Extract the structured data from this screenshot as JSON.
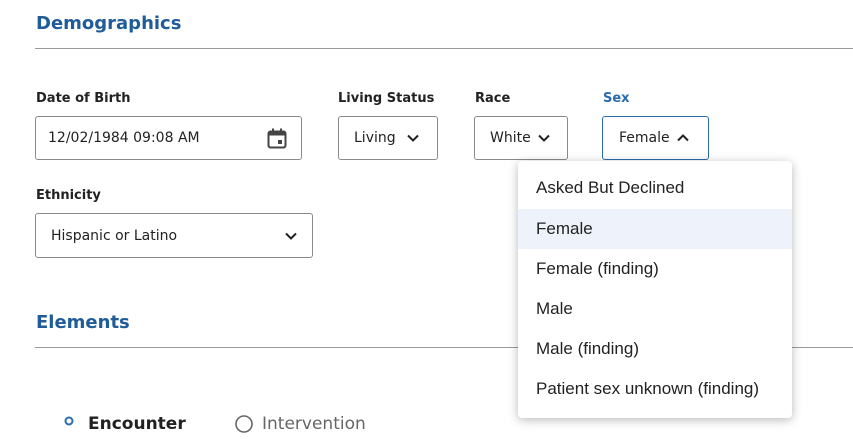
{
  "demographics": {
    "title": "Demographics",
    "dob": {
      "label": "Date of Birth",
      "value": "12/02/1984 09:08 AM",
      "icon": "calendar-icon"
    },
    "living_status": {
      "label": "Living Status",
      "value": "Living"
    },
    "race": {
      "label": "Race",
      "value": "White"
    },
    "sex": {
      "label": "Sex",
      "value": "Female",
      "options": [
        "Asked But Declined",
        "Female",
        "Female (finding)",
        "Male",
        "Male (finding)",
        "Patient sex unknown (finding)"
      ],
      "selected": "Female"
    },
    "ethnicity": {
      "label": "Ethnicity",
      "value": "Hispanic or Latino"
    }
  },
  "elements": {
    "title": "Elements",
    "tabs": [
      {
        "label": "Encounter",
        "icon": "map-pin-icon"
      },
      {
        "label": "Intervention",
        "icon": "intervention-icon"
      }
    ]
  },
  "colors": {
    "accent": "#2a6cb0",
    "title": "#1f5c99",
    "selected_bg": "#eef3fb"
  }
}
